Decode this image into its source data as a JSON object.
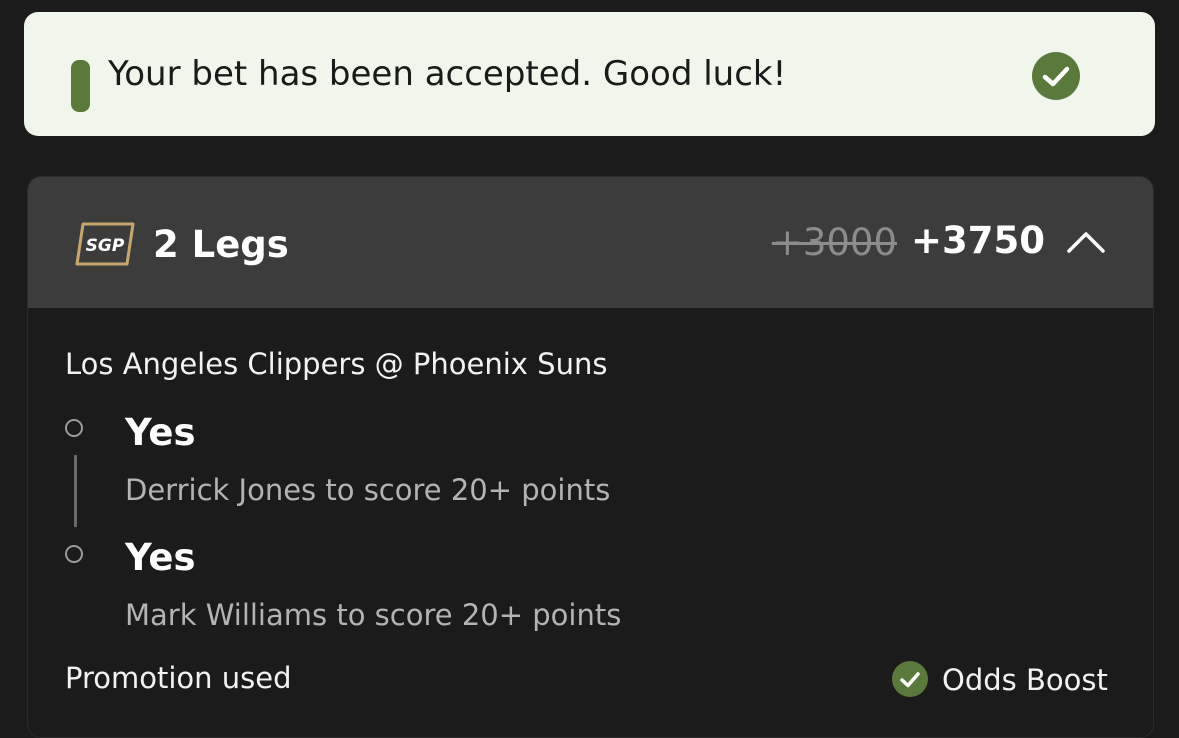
{
  "toast": {
    "message": "Your bet has been accepted. Good luck!",
    "icon": "check-circle-icon",
    "color": "#5a7a3c"
  },
  "bet": {
    "badge": "SGP",
    "legs_label": "2 Legs",
    "original_odds": "+3000",
    "boosted_odds": "+3750",
    "toggle_icon": "chevron-up-icon",
    "matchup": "Los Angeles Clippers @ Phoenix Suns",
    "legs": [
      {
        "selection": "Yes",
        "description": "Derrick Jones to score 20+ points"
      },
      {
        "selection": "Yes",
        "description": "Mark Williams to score 20+ points"
      }
    ],
    "promotion": {
      "label": "Promotion used",
      "value": "Odds Boost",
      "icon": "check-circle-icon"
    },
    "badge_color": "#c8a86a"
  }
}
